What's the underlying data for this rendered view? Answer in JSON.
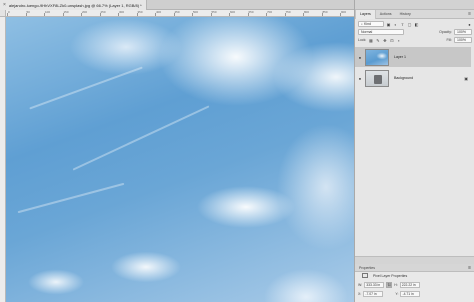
{
  "document": {
    "tab_title": "alejandro-luengo-9HhVXF8LZk0-unsplash.jpg @ 66.7% (Layer 1, RGB/8) *",
    "close_glyph": "×"
  },
  "ruler": {
    "top_labels": [
      "0",
      "50",
      "100",
      "150",
      "200",
      "250",
      "300",
      "350",
      "400",
      "450",
      "500",
      "550",
      "600",
      "650",
      "700",
      "750",
      "800",
      "850",
      "900"
    ]
  },
  "panel": {
    "tabs": [
      {
        "label": "Layers"
      },
      {
        "label": "Actions"
      },
      {
        "label": "History"
      }
    ],
    "menu_glyph": "≡",
    "filter_kind": "Kind",
    "blend_mode": "Normal",
    "opacity_label": "Opacity:",
    "opacity_value": "100%",
    "lock_label": "Lock:",
    "fill_label": "Fill:",
    "fill_value": "100%",
    "layers": [
      {
        "name": "Layer 1",
        "selected": true,
        "thumb": "sky"
      },
      {
        "name": "Background",
        "selected": false,
        "thumb": "photo",
        "locked": true
      }
    ],
    "eye_glyph": "👁",
    "lock_glyph": "🔒"
  },
  "properties": {
    "title": "Properties",
    "subtitle": "Pixel Layer Properties",
    "w_label": "W:",
    "w_value": "333.33 in",
    "h_label": "H:",
    "h_value": "222.22 in",
    "x_label": "X:",
    "x_value": "-7.07 in",
    "y_label": "Y:",
    "y_value": "-4.71 in",
    "link_glyph": "⛓",
    "menu_glyph": "≡"
  }
}
